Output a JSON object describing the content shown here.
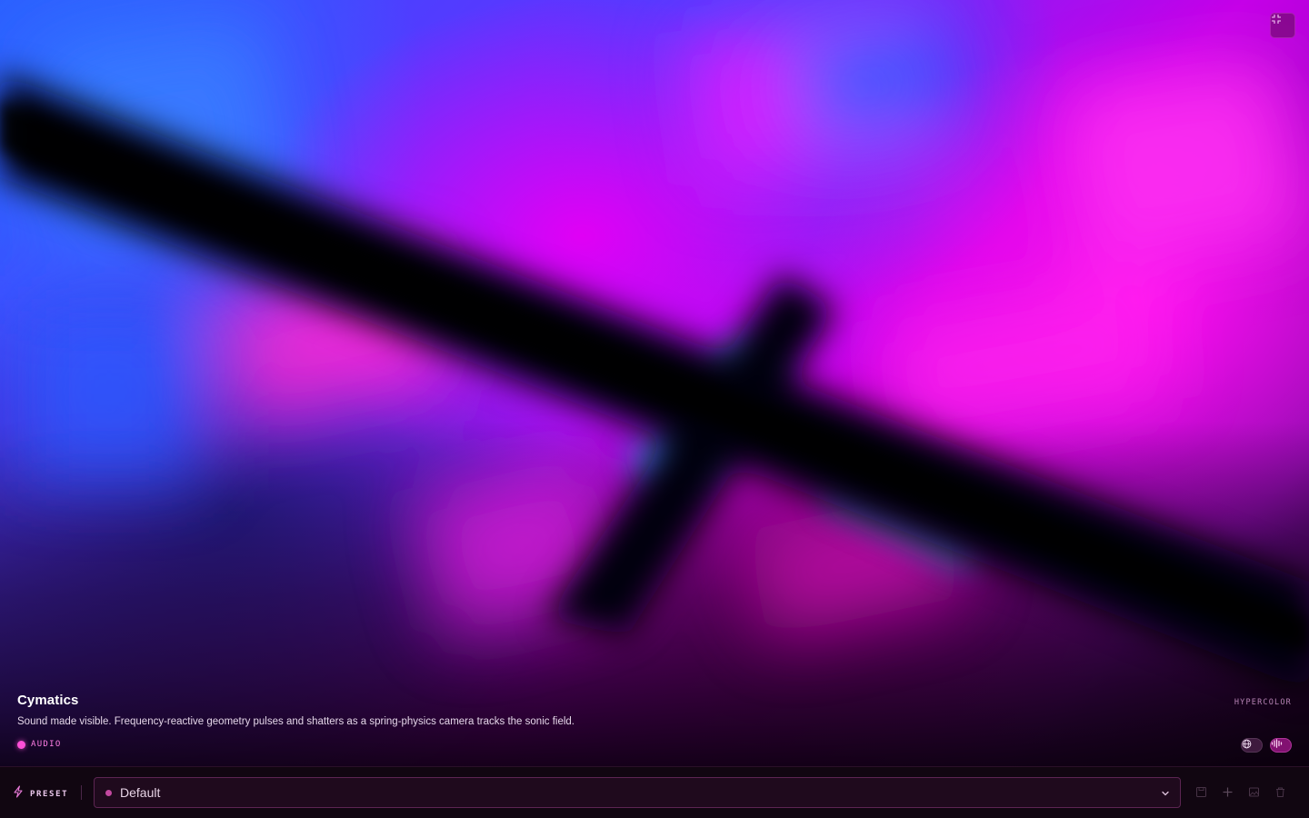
{
  "visual": {
    "title": "Cymatics",
    "description": "Sound made visible. Frequency-reactive geometry pulses and shatters as a spring-physics camera tracks the sonic field.",
    "tag": "AUDIO",
    "brand": "HYPERCOLOR"
  },
  "preset": {
    "label": "PRESET",
    "selected": "Default"
  },
  "colors": {
    "accent": "#ff4fd8",
    "bar_background": "#110611",
    "select_border": "#5c2552"
  },
  "icons": {
    "maximize": "exit-fullscreen-icon",
    "preset": "lightning-icon",
    "chevron": "chevron-down-icon",
    "globe": "globe-icon",
    "wave": "audio-wave-icon",
    "tools": [
      "save-icon",
      "add-icon",
      "image-icon",
      "trash-icon"
    ]
  }
}
